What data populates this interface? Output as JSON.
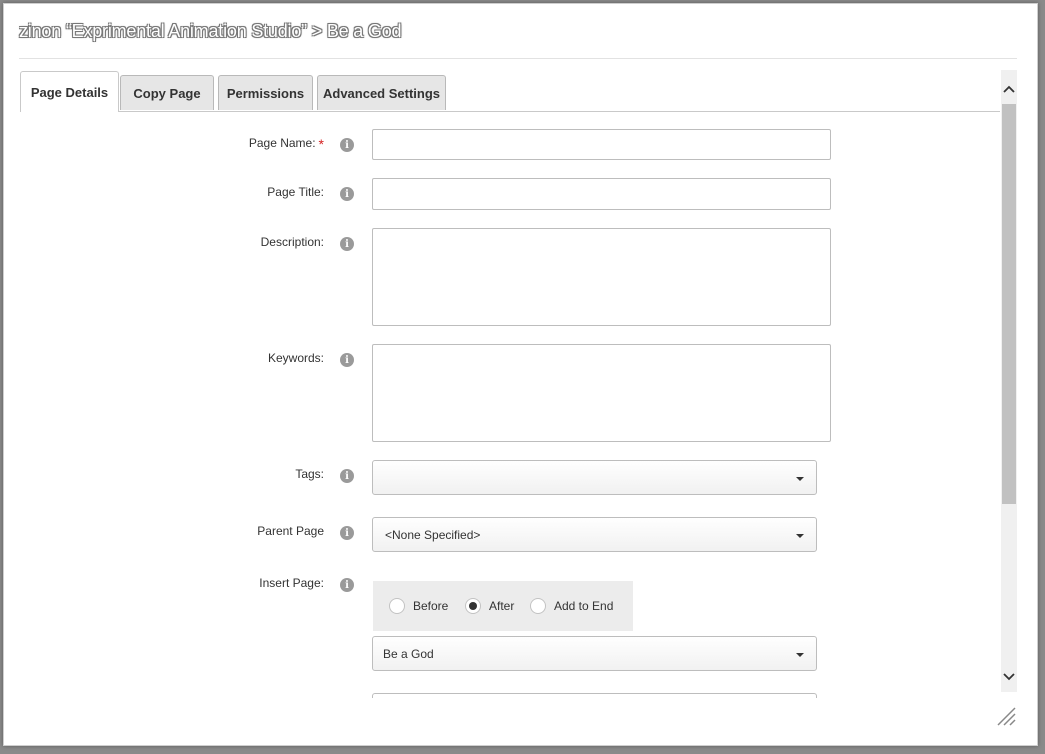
{
  "dialog": {
    "title": "zinon “Exprimental Animation Studio” > Be a God"
  },
  "tabs": [
    {
      "label": "Page Details",
      "active": true
    },
    {
      "label": "Copy Page",
      "active": false
    },
    {
      "label": "Permissions",
      "active": false
    },
    {
      "label": "Advanced Settings",
      "active": false
    }
  ],
  "form": {
    "page_name": {
      "label": "Page Name:",
      "required_mark": "*",
      "value": ""
    },
    "page_title": {
      "label": "Page Title:",
      "value": ""
    },
    "description": {
      "label": "Description:",
      "value": ""
    },
    "keywords": {
      "label": "Keywords:",
      "value": ""
    },
    "tags": {
      "label": "Tags:",
      "value": ""
    },
    "parent_page": {
      "label": "Parent Page",
      "value": "<None Specified>"
    },
    "insert_page": {
      "label": "Insert Page:",
      "options": [
        {
          "label": "Before",
          "checked": false
        },
        {
          "label": "After",
          "checked": true
        },
        {
          "label": "Add to End",
          "checked": false
        }
      ],
      "reference_page": "Be a God"
    }
  },
  "icons": {
    "info": "info-icon",
    "info_glyph": "i"
  },
  "colors": {
    "required": "#d42020",
    "info_icon": "#9a9a9a",
    "active_tab": "#ffffff",
    "inactive_tab": "#e6e6e6"
  }
}
